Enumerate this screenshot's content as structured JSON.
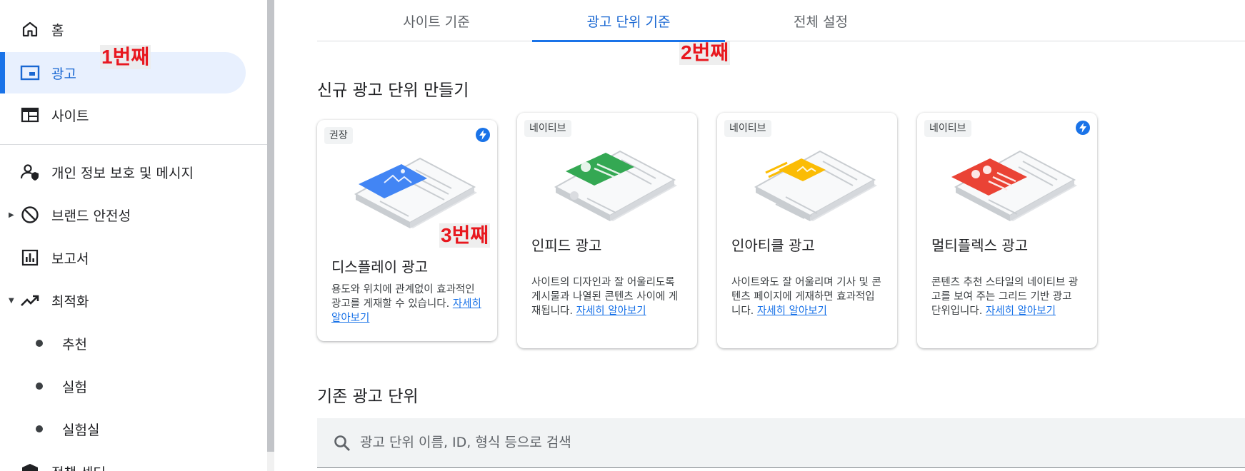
{
  "sidebar": {
    "items": [
      {
        "label": "홈",
        "icon": "home-icon"
      },
      {
        "label": "광고",
        "icon": "ads-icon",
        "active": true
      },
      {
        "label": "사이트",
        "icon": "sites-icon"
      },
      {
        "label": "개인 정보 보호 및 메시지",
        "icon": "privacy-icon"
      },
      {
        "label": "브랜드 안전성",
        "icon": "block-icon"
      },
      {
        "label": "보고서",
        "icon": "reports-icon"
      },
      {
        "label": "최적화",
        "icon": "trending-icon"
      },
      {
        "label": "추천"
      },
      {
        "label": "실험"
      },
      {
        "label": "실험실"
      },
      {
        "label": "정책 센터",
        "icon": "policy-icon"
      }
    ]
  },
  "annotations": {
    "first": "1번째",
    "second": "2번째",
    "third": "3번째"
  },
  "tabs": [
    {
      "label": "사이트 기준"
    },
    {
      "label": "광고 단위 기준",
      "active": true
    },
    {
      "label": "전체 설정"
    }
  ],
  "new_section_title": "신규 광고 단위 만들기",
  "existing_section_title": "기존 광고 단위",
  "cards": [
    {
      "chip": "권장",
      "title": "디스플레이 광고",
      "desc": "용도와 위치에 관계없이 효과적인 광고를 게재할 수 있습니다.",
      "link": "자세히 알아보기",
      "accent": "#4285f4"
    },
    {
      "chip": "네이티브",
      "title": "인피드 광고",
      "desc": "사이트의 디자인과 잘 어울리도록 게시물과 나열된 콘텐츠 사이에 게재됩니다.",
      "link": "자세히 알아보기",
      "accent": "#34a853"
    },
    {
      "chip": "네이티브",
      "title": "인아티클 광고",
      "desc": "사이트와도 잘 어울리며 기사 및 콘텐츠 페이지에 게재하면 효과적입니다.",
      "link": "자세히 알아보기",
      "accent": "#fbbc04"
    },
    {
      "chip": "네이티브",
      "title": "멀티플렉스 광고",
      "desc": "콘텐츠 추천 스타일의 네이티브 광고를 보여 주는 그리드 기반 광고 단위입니다.",
      "link": "자세히 알아보기",
      "accent": "#ea4335"
    }
  ],
  "search": {
    "placeholder": "광고 단위 이름, ID, 형식 등으로 검색",
    "value": ""
  }
}
